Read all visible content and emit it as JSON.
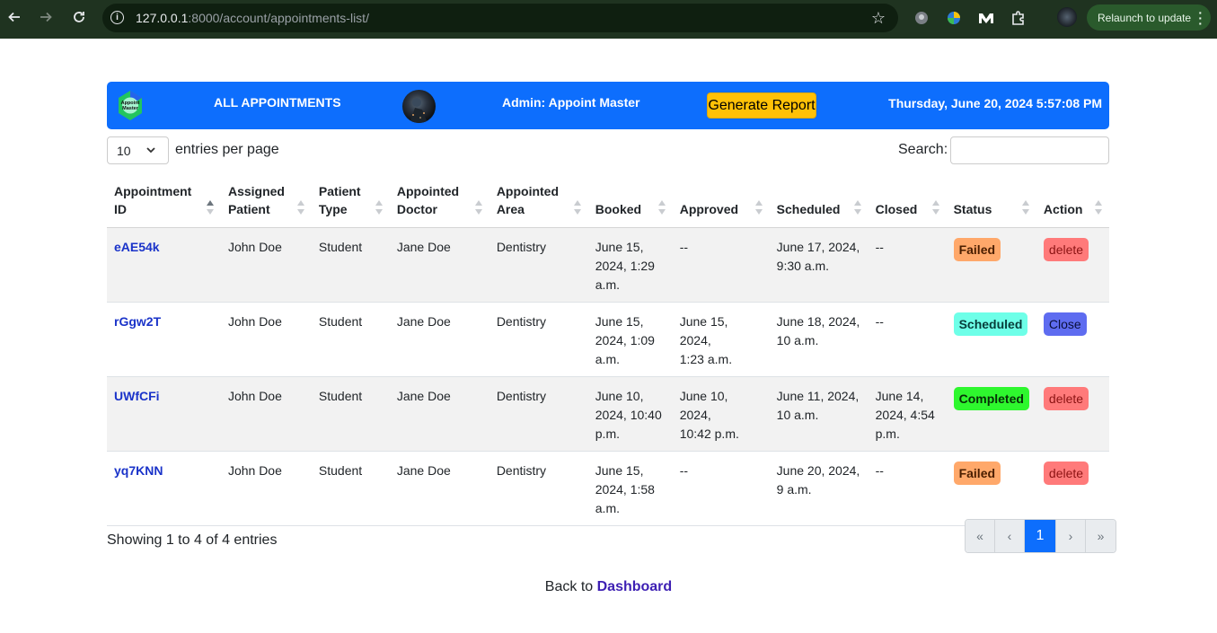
{
  "browser": {
    "url_host": "127.0.0.1",
    "url_rest": ":8000/account/appointments-list/",
    "relaunch_label": "Relaunch to update"
  },
  "header": {
    "logo_text": "Appoint Master",
    "title": "ALL APPOINTMENTS",
    "admin": "Admin: Appoint Master",
    "report_button": "Generate Report",
    "datetime": "Thursday, June 20, 2024 5:57:08 PM",
    "bg_color": "#0d6efd"
  },
  "controls": {
    "per_page_value": "10",
    "per_page_label": "entries per page",
    "search_label": "Search:",
    "search_value": ""
  },
  "table": {
    "columns": [
      {
        "line1": "Appointment",
        "line2": "ID"
      },
      {
        "line1": "Assigned",
        "line2": "Patient"
      },
      {
        "line1": "Patient",
        "line2": "Type"
      },
      {
        "line1": "Appointed",
        "line2": "Doctor"
      },
      {
        "line1": "Appointed",
        "line2": "Area"
      },
      {
        "line1": "",
        "line2": "Booked"
      },
      {
        "line1": "",
        "line2": "Approved"
      },
      {
        "line1": "",
        "line2": "Scheduled"
      },
      {
        "line1": "",
        "line2": "Closed"
      },
      {
        "line1": "",
        "line2": "Status"
      },
      {
        "line1": "",
        "line2": "Action"
      }
    ],
    "rows": [
      {
        "id": "eAE54k",
        "patient": "John Doe",
        "type": "Student",
        "doctor": "Jane Doe",
        "area": "Dentistry",
        "booked": [
          "June 15,",
          "2024, 1:29",
          "a.m."
        ],
        "approved": [
          "--"
        ],
        "scheduled": [
          "June 17, 2024,",
          "9:30 a.m."
        ],
        "closed": [
          "--"
        ],
        "status": "Failed",
        "action": "delete"
      },
      {
        "id": "rGgw2T",
        "patient": "John Doe",
        "type": "Student",
        "doctor": "Jane Doe",
        "area": "Dentistry",
        "booked": [
          "June 15,",
          "2024, 1:09",
          "a.m."
        ],
        "approved": [
          "June 15, 2024,",
          "1:23 a.m."
        ],
        "scheduled": [
          "June 18, 2024,",
          "10 a.m."
        ],
        "closed": [
          "--"
        ],
        "status": "Scheduled",
        "action": "Close"
      },
      {
        "id": "UWfCFi",
        "patient": "John Doe",
        "type": "Student",
        "doctor": "Jane Doe",
        "area": "Dentistry",
        "booked": [
          "June 10,",
          "2024, 10:40",
          "p.m."
        ],
        "approved": [
          "June 10, 2024,",
          "10:42 p.m."
        ],
        "scheduled": [
          "June 11, 2024,",
          "10 a.m."
        ],
        "closed": [
          "June 14,",
          "2024, 4:54",
          "p.m."
        ],
        "status": "Completed",
        "action": "delete"
      },
      {
        "id": "yq7KNN",
        "patient": "John Doe",
        "type": "Student",
        "doctor": "Jane Doe",
        "area": "Dentistry",
        "booked": [
          "June 15,",
          "2024, 1:58",
          "a.m."
        ],
        "approved": [
          "--"
        ],
        "scheduled": [
          "June 20, 2024,",
          "9 a.m."
        ],
        "closed": [
          "--"
        ],
        "status": "Failed",
        "action": "delete"
      }
    ]
  },
  "footer": {
    "showing": "Showing 1 to 4 of 4 entries",
    "pager": {
      "first": "«",
      "prev": "‹",
      "current": "1",
      "next": "›",
      "last": "»"
    },
    "back_prefix": "Back to",
    "back_link": "Dashboard"
  }
}
